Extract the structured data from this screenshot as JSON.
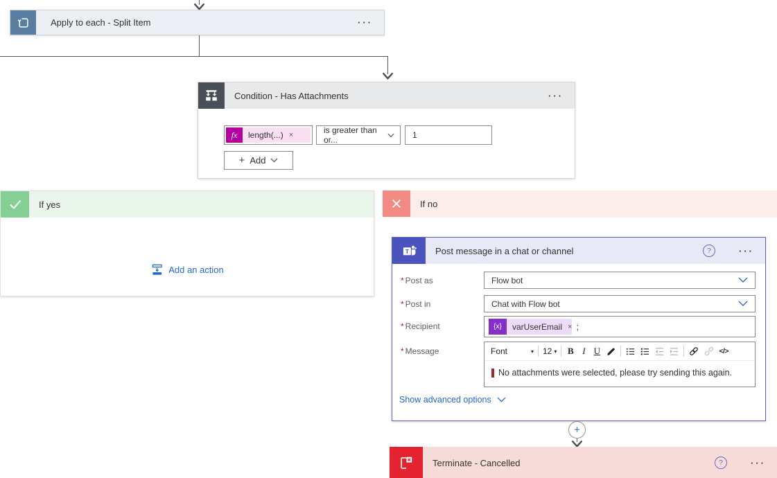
{
  "apply_to_each": {
    "title": "Apply to each - Split Item",
    "menu": "···"
  },
  "condition": {
    "title": "Condition - Has Attachments",
    "menu": "···",
    "token_label": "length(...)",
    "token_remove": "×",
    "operator": "is greater than or...",
    "value": "1",
    "add_plus": "+",
    "add_label": "Add"
  },
  "if_yes": {
    "title": "If yes",
    "add_action_label": "Add an action"
  },
  "if_no": {
    "title": "If no"
  },
  "teams": {
    "title": "Post message in a chat or channel",
    "help": "?",
    "menu": "···",
    "required_mark": "*",
    "post_as": {
      "label": "Post as",
      "value": "Flow bot"
    },
    "post_in": {
      "label": "Post in",
      "value": "Chat with Flow bot"
    },
    "recipient": {
      "label": "Recipient",
      "token": "varUserEmail",
      "token_remove": "×",
      "suffix": ";"
    },
    "message": {
      "label": "Message",
      "text": "No attachments were selected, please try sending this again."
    },
    "toolbar": {
      "font": "Font",
      "font_caret": "▾",
      "size": "12",
      "size_caret": "▾",
      "bold": "B",
      "italic": "I",
      "underline": "U",
      "code": "</>"
    },
    "show_advanced": "Show advanced options"
  },
  "terminate": {
    "title": "Terminate - Cancelled",
    "help": "?",
    "menu": "···"
  },
  "connectors": {
    "insert_plus": "+"
  },
  "colors": {
    "apply_accent": "#5a7da2",
    "condition_accent": "#484f58",
    "if_yes_accent": "#84cf94",
    "if_no_accent": "#f18b84",
    "teams_accent": "#4b53bc",
    "terminate_accent": "#e42330",
    "fx_accent": "#b4009e",
    "token_accent": "#8430c8",
    "link_blue": "#2266d1",
    "connector": "#53575e"
  }
}
